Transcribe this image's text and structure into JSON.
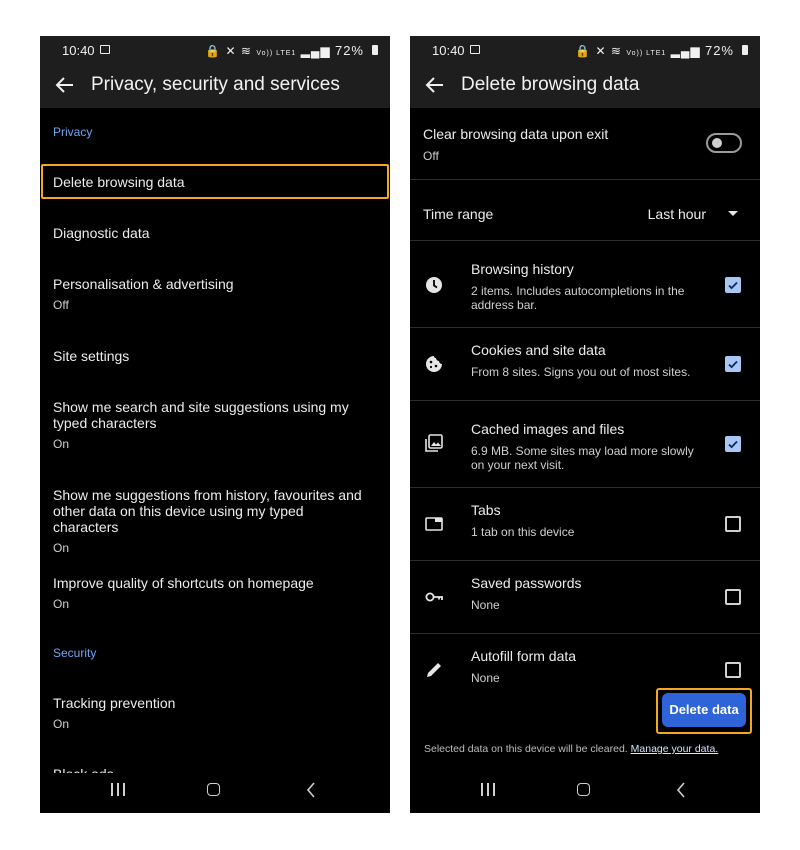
{
  "status_bar": {
    "time": "10:40",
    "signal_text": "Vo)) LTE1",
    "battery": "72%"
  },
  "left_screen": {
    "title": "Privacy, security and services",
    "sections": [
      {
        "label": "Privacy"
      },
      {
        "label": "Security"
      }
    ],
    "items": [
      {
        "title": "Delete browsing data",
        "subtitle": ""
      },
      {
        "title": "Diagnostic data",
        "subtitle": ""
      },
      {
        "title": "Personalisation & advertising",
        "subtitle": "Off"
      },
      {
        "title": "Site settings",
        "subtitle": ""
      },
      {
        "title": "Show me search and site suggestions using my typed characters",
        "subtitle": "On"
      },
      {
        "title": "Show me suggestions from history, favourites and other data on this device using my typed characters",
        "subtitle": "On"
      },
      {
        "title": "Improve quality of shortcuts on homepage",
        "subtitle": "On"
      },
      {
        "title": "Tracking prevention",
        "subtitle": "On"
      },
      {
        "title": "Block ads",
        "subtitle": ""
      }
    ]
  },
  "right_screen": {
    "title": "Delete browsing data",
    "clear_on_exit": {
      "label": "Clear browsing data upon exit",
      "state": "Off",
      "enabled": false
    },
    "time_range": {
      "label": "Time range",
      "value": "Last hour"
    },
    "options": [
      {
        "icon": "clock-icon",
        "title": "Browsing history",
        "subtitle": "2 items. Includes autocompletions in the address bar.",
        "checked": true
      },
      {
        "icon": "cookie-icon",
        "title": "Cookies and site data",
        "subtitle": "From 8 sites. Signs you out of most sites.",
        "checked": true
      },
      {
        "icon": "images-icon",
        "title": "Cached images and files",
        "subtitle": "6.9 MB. Some sites may load more slowly on your next visit.",
        "checked": true
      },
      {
        "icon": "tab-icon",
        "title": "Tabs",
        "subtitle": "1 tab on this device",
        "checked": false
      },
      {
        "icon": "key-icon",
        "title": "Saved passwords",
        "subtitle": "None",
        "checked": false
      },
      {
        "icon": "pencil-icon",
        "title": "Autofill form data",
        "subtitle": "None",
        "checked": false
      }
    ],
    "delete_button": "Delete data",
    "footnote": "Selected data on this device will be cleared.",
    "manage_link": "Manage your data."
  },
  "colors": {
    "accent": "#6ea6f5",
    "highlight": "#f5a623",
    "button": "#2e64d8",
    "checkbox_on": "#a9c7f5"
  }
}
